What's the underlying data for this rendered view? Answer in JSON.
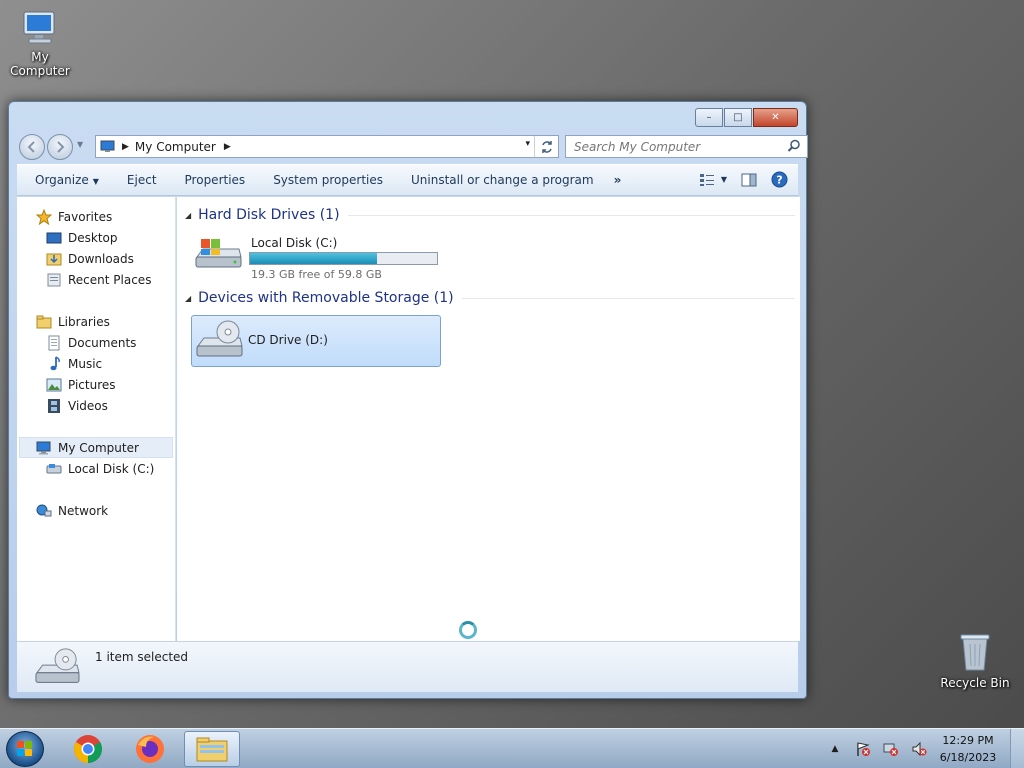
{
  "desktop": {
    "icons": [
      {
        "label": "My Computer"
      },
      {
        "label": "Recycle Bin"
      }
    ]
  },
  "window": {
    "caption_buttons": {
      "minimize": "–",
      "maximize": "□",
      "close": "✕"
    },
    "address": {
      "crumbs": [
        "My Computer"
      ],
      "dropdown": "▾"
    },
    "search": {
      "placeholder": "Search My Computer"
    },
    "commands": {
      "organize": "Organize",
      "eject": "Eject",
      "properties": "Properties",
      "system_properties": "System properties",
      "uninstall": "Uninstall or change a program",
      "more": "»"
    },
    "nav": {
      "favorites": {
        "label": "Favorites",
        "items": [
          "Desktop",
          "Downloads",
          "Recent Places"
        ]
      },
      "libraries": {
        "label": "Libraries",
        "items": [
          "Documents",
          "Music",
          "Pictures",
          "Videos"
        ]
      },
      "computer": {
        "label": "My Computer",
        "items": [
          "Local Disk (C:)"
        ]
      },
      "network": {
        "label": "Network"
      }
    },
    "groups": {
      "hard_disk": {
        "header": "Hard Disk Drives (1)",
        "drive": {
          "name": "Local Disk (C:)",
          "free_text": "19.3 GB free of 59.8 GB",
          "used_fraction": 0.677
        }
      },
      "removable": {
        "header": "Devices with Removable Storage (1)",
        "drive": {
          "name": "CD Drive (D:)"
        }
      }
    },
    "details": {
      "text": "1 item selected"
    }
  },
  "taskbar": {
    "clock": {
      "time": "12:29 PM",
      "date": "6/18/2023"
    },
    "apps": [
      "start-orb",
      "chrome",
      "firefox",
      "explorer"
    ]
  },
  "colors": {
    "window_frame": "#c9dcf2",
    "selection": "#c1dcfb",
    "group_header": "#1e3287",
    "progress_fill": "#1b8db5"
  }
}
